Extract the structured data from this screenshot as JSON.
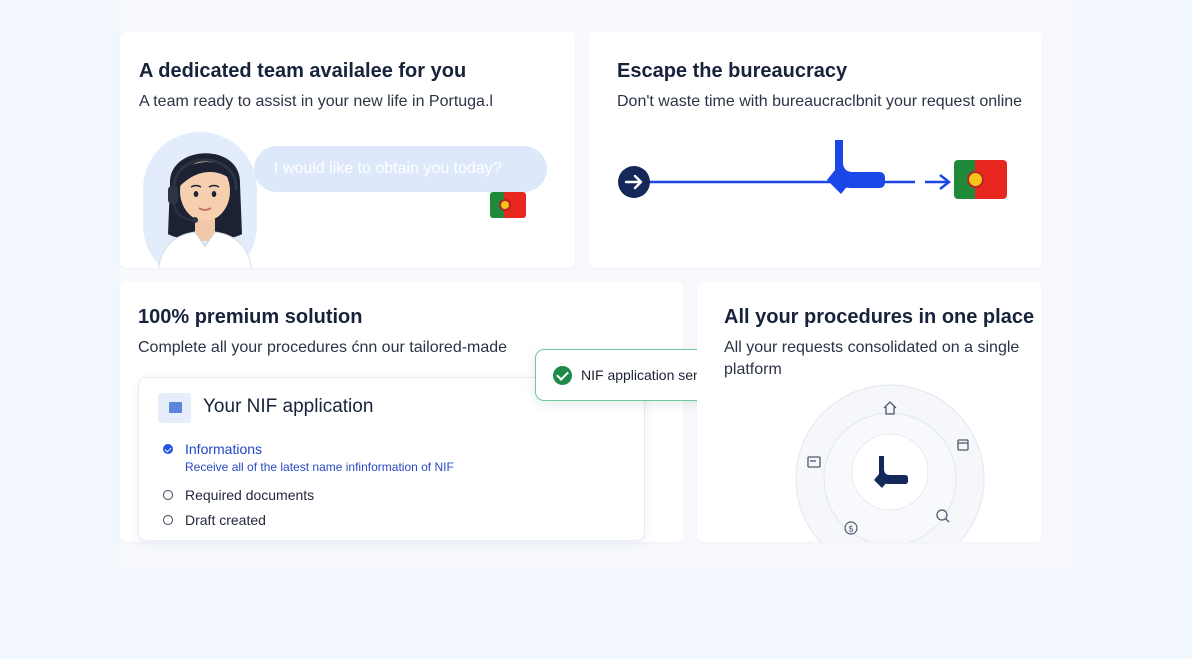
{
  "cards": {
    "team": {
      "title": "A dedicated team availalee for you",
      "subtitle": "A team ready to assist in your new life in Portuga.l",
      "bubble": "I would like to obtain you today?"
    },
    "bureaucracy": {
      "title": "Escape the bureaucracy",
      "subtitle": "Don't waste time with bureaucraclbnit your request online"
    },
    "premium": {
      "title": "100% premium solution",
      "subtitle": "Complete all your procedures ćnn our tailored-made"
    },
    "procedures": {
      "title": "All your procedures in one place",
      "subtitle": "All your requests consolidated on a single platform"
    }
  },
  "nif": {
    "title": "Your NIF application",
    "steps": [
      {
        "label": "Informations",
        "sub": "Receive all of the latest name infinformation of NIF",
        "status": "done"
      },
      {
        "label": "Required documents",
        "status": "pending"
      },
      {
        "label": "Draft created",
        "status": "pending"
      }
    ]
  },
  "toast": {
    "text": "NIF application sent"
  },
  "colors": {
    "brand_blue": "#1b47e6",
    "dark_navy": "#14285a",
    "accent_green": "#1e8a4a",
    "flag_green": "#1f8a3a",
    "flag_red": "#e8271f"
  },
  "icons": [
    "headset-agent-icon",
    "portugal-flag-icon",
    "arrow-right-icon",
    "brand-logo-icon",
    "home-icon",
    "store-icon",
    "card-icon",
    "chat-search-icon",
    "dollar-icon",
    "document-icon",
    "check-icon"
  ]
}
